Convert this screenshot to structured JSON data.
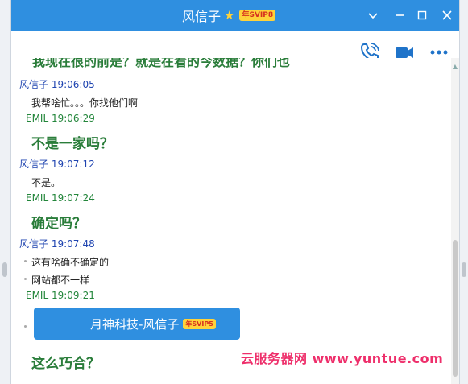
{
  "window": {
    "title": "风信子",
    "vip_badge": "年SVIP8"
  },
  "chat": {
    "cut_line": "我现在很的前是？就是在看的今数据？你们也",
    "messages": [
      {
        "time": "风信子  19:06:05",
        "text": "我帮啥忙。。。你找他们啊"
      },
      {
        "time": "EMIL  19:06:29",
        "text": "不是一家吗？"
      },
      {
        "time": "风信子  19:07:12",
        "text": "不是。"
      },
      {
        "time": "EMIL  19:07:24",
        "text": "确定吗？"
      },
      {
        "time": "风信子  19:07:48",
        "text": "这有啥确不确定的",
        "text2": "网站都不一样"
      },
      {
        "time": "EMIL  19:09:21",
        "text": "这么巧合？"
      }
    ]
  },
  "popup": {
    "label": "月神科技-风信子",
    "badge": "年SVIP5"
  },
  "watermark": "云服务器网 www.yuntue.com"
}
